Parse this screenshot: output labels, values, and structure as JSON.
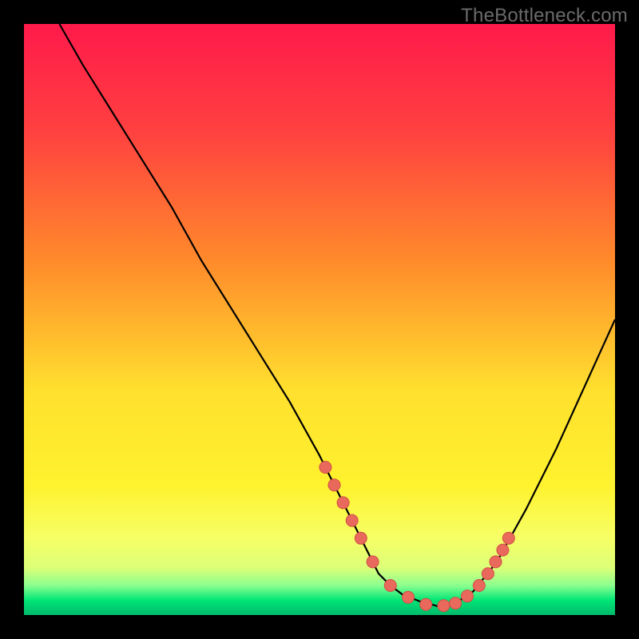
{
  "watermark": "TheBottleneck.com",
  "colors": {
    "frame": "#000000",
    "watermark_text": "#6b6b6b",
    "curve": "#000000",
    "marker_fill": "#e9695c",
    "marker_stroke": "#d14f45",
    "gradient_top": "#ff1a4b",
    "gradient_mid1": "#ff8a2b",
    "gradient_mid2": "#ffe02e",
    "gradient_low": "#f6ff66",
    "gradient_bottom1": "#dcff78",
    "gradient_bottom2": "#8bff8e",
    "gradient_bottom3": "#00e676",
    "gradient_bottom4": "#00b96a"
  },
  "chart_data": {
    "type": "line",
    "title": "",
    "xlabel": "",
    "ylabel": "",
    "xlim": [
      0,
      100
    ],
    "ylim": [
      0,
      100
    ],
    "series": [
      {
        "name": "bottleneck-curve",
        "x": [
          6,
          10,
          15,
          20,
          25,
          30,
          35,
          40,
          45,
          50,
          53,
          56,
          58,
          60,
          62,
          64,
          67,
          70,
          73,
          76,
          80,
          85,
          90,
          95,
          100
        ],
        "y": [
          100,
          93,
          85,
          77,
          69,
          60,
          52,
          44,
          36,
          27,
          21,
          15,
          11,
          7,
          5,
          3.5,
          2.3,
          1.5,
          2,
          4,
          9,
          18,
          28,
          39,
          50
        ]
      }
    ],
    "markers": {
      "name": "highlight-dots",
      "x": [
        51,
        52.5,
        54,
        55.5,
        57,
        59,
        62,
        65,
        68,
        71,
        73,
        75,
        77,
        78.5,
        79.8,
        81,
        82
      ],
      "y": [
        25,
        22,
        19,
        16,
        13,
        9,
        5,
        3,
        1.8,
        1.6,
        2,
        3.2,
        5,
        7,
        9,
        11,
        13
      ]
    }
  }
}
